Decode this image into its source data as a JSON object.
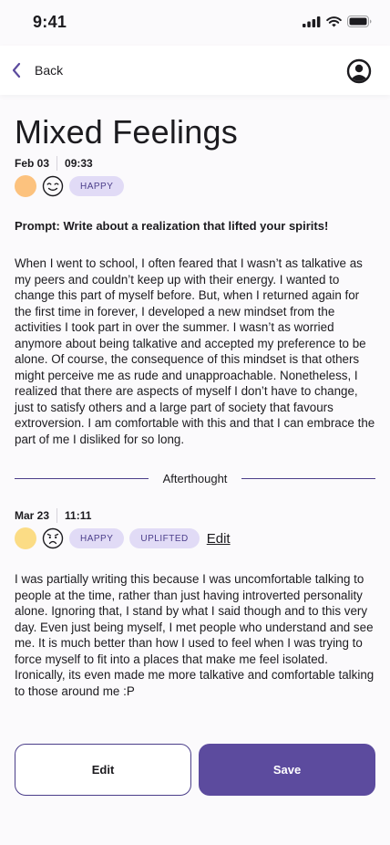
{
  "status_bar": {
    "time": "9:41"
  },
  "header": {
    "back_label": "Back"
  },
  "entry": {
    "title": "Mixed Feelings",
    "date": "Feb 03",
    "time": "09:33",
    "tags": [
      "HAPPY"
    ],
    "mood_color": "#FCC27E",
    "prompt": "Prompt: Write about a realization that lifted your spirits!",
    "body": "When I went to school, I often feared that I wasn’t as talkative as my peers and couldn’t keep up with their energy. I wanted to change this part of myself before. But, when I returned again for the first time in forever, I developed a new mindset from the activities I took part in over the summer. I wasn’t as worried anymore about being talkative and accepted my preference to be alone. Of course, the consequence of this mindset is that others might perceive me as rude and unapproachable. Nonetheless, I realized that there are aspects of myself I don’t have to change, just to satisfy others and a large part of society that favours extroversion. I am comfortable with this and that I can embrace the part of me I disliked for so long."
  },
  "afterthought": {
    "label": "Afterthought",
    "date": "Mar 23",
    "time": "11:11",
    "tags": [
      "HAPPY",
      "UPLIFTED"
    ],
    "mood_color": "#FBDC85",
    "edit_label": "Edit",
    "body": "I was partially writing this because I was uncomfortable talking to people at the time, rather than just having introverted personality alone. Ignoring that, I stand by what I said though and to this very day. Even just being myself, I met people who understand and see me. It is much better than how I used to feel when I was trying to force myself to fit into a places that make me feel isolated. Ironically, its even made me more talkative and comfortable talking to those around me :P"
  },
  "actions": {
    "edit_label": "Edit",
    "save_label": "Save"
  },
  "colors": {
    "accent": "#5C4B9E",
    "pill_bg": "#E1DBF6",
    "pill_text": "#4B3E8A"
  },
  "icons": [
    "signal-icon",
    "wifi-icon",
    "battery-icon",
    "chevron-left-icon",
    "profile-icon",
    "relieved-face-icon",
    "sad-face-icon"
  ]
}
